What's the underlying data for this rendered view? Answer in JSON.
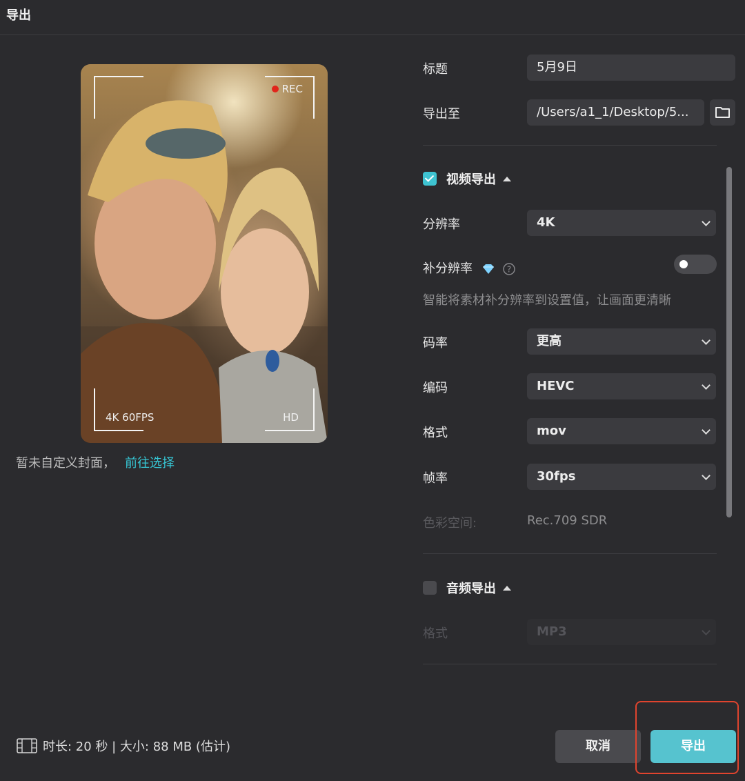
{
  "window": {
    "title": "导出"
  },
  "preview": {
    "rec_label": "REC",
    "quality_label": "4K 60FPS",
    "hd_label": "HD",
    "cover_note": "暂未自定义封面，",
    "cover_link": "前往选择"
  },
  "form": {
    "title_label": "标题",
    "title_value": "5月9日",
    "export_to_label": "导出至",
    "export_to_value": "/Users/a1_1/Desktop/5...",
    "video_section": {
      "label": "视频导出",
      "checked": true
    },
    "resolution_label": "分辨率",
    "resolution_value": "4K",
    "upscale_label": "补分辨率",
    "upscale_hint": "智能将素材补分辨率到设置值，让画面更清晰",
    "bitrate_label": "码率",
    "bitrate_value": "更高",
    "codec_label": "编码",
    "codec_value": "HEVC",
    "format_label": "格式",
    "format_value": "mov",
    "framerate_label": "帧率",
    "framerate_value": "30fps",
    "colorspace_label": "色彩空间:",
    "colorspace_value": "Rec.709 SDR",
    "audio_section": {
      "label": "音频导出",
      "checked": false
    },
    "audio_format_label": "格式",
    "audio_format_value": "MP3"
  },
  "footer": {
    "info": "时长: 20 秒 | 大小: 88 MB (估计)",
    "cancel_label": "取消",
    "export_label": "导出"
  },
  "colors": {
    "accent": "#56c3cf",
    "highlight_box": "#e0442e",
    "background": "#2b2b2e"
  }
}
